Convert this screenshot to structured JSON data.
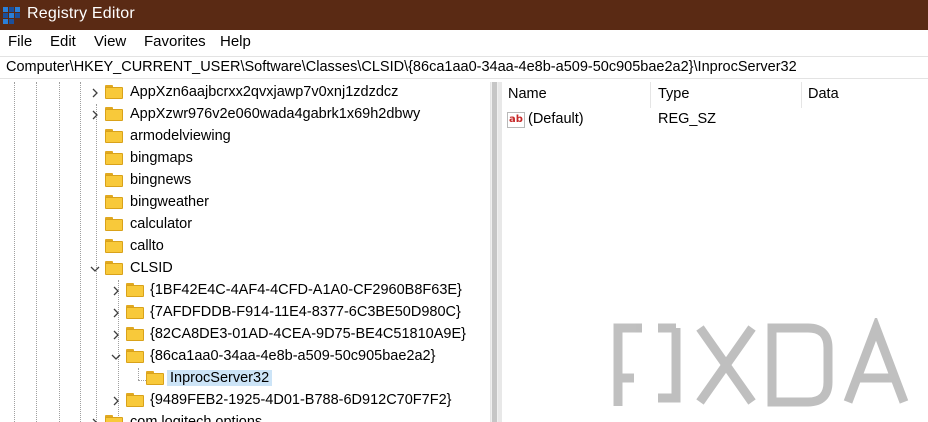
{
  "window": {
    "title": "Registry Editor"
  },
  "menu": [
    "File",
    "Edit",
    "View",
    "Favorites",
    "Help"
  ],
  "address": {
    "path": "Computer\\HKEY_CURRENT_USER\\Software\\Classes\\CLSID\\{86ca1aa0-34aa-4e8b-a509-50c905bae2a2}\\InprocServer32"
  },
  "tree": {
    "items": [
      {
        "label": "AppXzn6aajbcrxx2qvxjawp7v0xnj1zdzdcz",
        "chevron": "right"
      },
      {
        "label": "AppXzwr976v2e060wada4gabrk1x69h2dbwy",
        "chevron": "right"
      },
      {
        "label": "armodelviewing",
        "chevron": "none"
      },
      {
        "label": "bingmaps",
        "chevron": "none"
      },
      {
        "label": "bingnews",
        "chevron": "none"
      },
      {
        "label": "bingweather",
        "chevron": "none"
      },
      {
        "label": "calculator",
        "chevron": "none"
      },
      {
        "label": "callto",
        "chevron": "none"
      },
      {
        "label": "CLSID",
        "chevron": "down"
      },
      {
        "label": "{1BF42E4C-4AF4-4CFD-A1A0-CF2960B8F63E}",
        "chevron": "right"
      },
      {
        "label": "{7AFDFDDB-F914-11E4-8377-6C3BE50D980C}",
        "chevron": "right"
      },
      {
        "label": "{82CA8DE3-01AD-4CEA-9D75-BE4C51810A9E}",
        "chevron": "right"
      },
      {
        "label": "{86ca1aa0-34aa-4e8b-a509-50c905bae2a2}",
        "chevron": "down"
      },
      {
        "label": "InprocServer32",
        "chevron": "none",
        "selected": true
      },
      {
        "label": "{9489FEB2-1925-4D01-B788-6D912C70F7F2}",
        "chevron": "right"
      },
      {
        "label": "com.logitech.options",
        "chevron": "right"
      }
    ]
  },
  "list": {
    "columns": [
      "Name",
      "Type",
      "Data"
    ],
    "rows": [
      {
        "icon": "string-value-icon",
        "name": "(Default)",
        "type": "REG_SZ",
        "data": ""
      }
    ]
  },
  "colors": {
    "titlebar": "#5a2a14",
    "selection": "#cce4f7",
    "folder": "#f8c93a"
  },
  "watermark": {
    "logo": "XDA"
  }
}
